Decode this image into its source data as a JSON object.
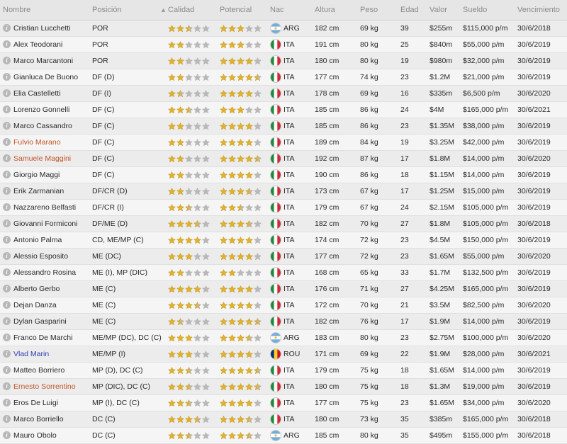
{
  "header": {
    "nombre": "Nombre",
    "posicion": "Posición",
    "calidad": "Calidad",
    "sort_arrow": "▲",
    "potencial": "Potencial",
    "nac": "Nac",
    "altura": "Altura",
    "peso": "Peso",
    "edad": "Edad",
    "valor": "Valor",
    "sueldo": "Sueldo",
    "vencimiento": "Vencimiento"
  },
  "colors": {
    "star_gold": "#e2b22a",
    "star_empty": "#b9b9b9",
    "name_orange": "#c0562a",
    "name_blue": "#2d3db0"
  },
  "players": [
    {
      "name": "Cristian Lucchetti",
      "name_color": "normal",
      "position": "POR",
      "quality": 2.5,
      "potential": 3.0,
      "nationality": "ARG",
      "height": "182 cm",
      "weight": "69 kg",
      "age": "39",
      "value": "$255m",
      "salary": "$115,000 p/m",
      "expiry": "30/6/2018"
    },
    {
      "name": "Alex Teodorani",
      "name_color": "normal",
      "position": "POR",
      "quality": 2.0,
      "potential": 3.0,
      "nationality": "ITA",
      "height": "191 cm",
      "weight": "80 kg",
      "age": "25",
      "value": "$840m",
      "salary": "$55,000 p/m",
      "expiry": "30/6/2019"
    },
    {
      "name": "Marco Marcantoni",
      "name_color": "normal",
      "position": "POR",
      "quality": 2.0,
      "potential": 4.0,
      "nationality": "ITA",
      "height": "180 cm",
      "weight": "80 kg",
      "age": "19",
      "value": "$980m",
      "salary": "$32,000 p/m",
      "expiry": "30/6/2019"
    },
    {
      "name": "Gianluca De Buono",
      "name_color": "normal",
      "position": "DF (D)",
      "quality": 2.0,
      "potential": 4.5,
      "nationality": "ITA",
      "height": "177 cm",
      "weight": "74 kg",
      "age": "23",
      "value": "$1.2M",
      "salary": "$21,000 p/m",
      "expiry": "30/6/2019"
    },
    {
      "name": "Elia Castelletti",
      "name_color": "normal",
      "position": "DF (I)",
      "quality": 1.5,
      "potential": 4.0,
      "nationality": "ITA",
      "height": "178 cm",
      "weight": "69 kg",
      "age": "16",
      "value": "$335m",
      "salary": "$6,500 p/m",
      "expiry": "30/6/2020"
    },
    {
      "name": "Lorenzo Gonnelli",
      "name_color": "normal",
      "position": "DF (C)",
      "quality": 2.5,
      "potential": 3.0,
      "nationality": "ITA",
      "height": "185 cm",
      "weight": "86 kg",
      "age": "24",
      "value": "$4M",
      "salary": "$165,000 p/m",
      "expiry": "30/6/2021"
    },
    {
      "name": "Marco Cassandro",
      "name_color": "normal",
      "position": "DF (C)",
      "quality": 2.0,
      "potential": 4.0,
      "nationality": "ITA",
      "height": "185 cm",
      "weight": "86 kg",
      "age": "23",
      "value": "$1.35M",
      "salary": "$38,000 p/m",
      "expiry": "30/6/2019"
    },
    {
      "name": "Fulvio Marano",
      "name_color": "orange",
      "position": "DF (C)",
      "quality": 2.0,
      "potential": 4.0,
      "nationality": "ITA",
      "height": "189 cm",
      "weight": "84 kg",
      "age": "19",
      "value": "$3.25M",
      "salary": "$42,000 p/m",
      "expiry": "30/6/2019"
    },
    {
      "name": "Samuele Maggini",
      "name_color": "orange",
      "position": "DF (C)",
      "quality": 2.0,
      "potential": 4.5,
      "nationality": "ITA",
      "height": "192 cm",
      "weight": "87 kg",
      "age": "17",
      "value": "$1.8M",
      "salary": "$14,000 p/m",
      "expiry": "30/6/2020"
    },
    {
      "name": "Giorgio Maggi",
      "name_color": "normal",
      "position": "DF (C)",
      "quality": 2.0,
      "potential": 4.0,
      "nationality": "ITA",
      "height": "190 cm",
      "weight": "86 kg",
      "age": "18",
      "value": "$1.15M",
      "salary": "$14,000 p/m",
      "expiry": "30/6/2019"
    },
    {
      "name": "Erik Zarmanian",
      "name_color": "normal",
      "position": "DF/CR (D)",
      "quality": 2.0,
      "potential": 3.5,
      "nationality": "ITA",
      "height": "173 cm",
      "weight": "67 kg",
      "age": "17",
      "value": "$1.25M",
      "salary": "$15,000 p/m",
      "expiry": "30/6/2019"
    },
    {
      "name": "Nazzareno Belfasti",
      "name_color": "normal",
      "position": "DF/CR (I)",
      "quality": 2.5,
      "potential": 2.5,
      "nationality": "ITA",
      "height": "179 cm",
      "weight": "67 kg",
      "age": "24",
      "value": "$2.15M",
      "salary": "$105,000 p/m",
      "expiry": "30/6/2019"
    },
    {
      "name": "Giovanni Formiconi",
      "name_color": "normal",
      "position": "DF/ME (D)",
      "quality": 3.5,
      "potential": 3.5,
      "nationality": "ITA",
      "height": "182 cm",
      "weight": "70 kg",
      "age": "27",
      "value": "$1.8M",
      "salary": "$105,000 p/m",
      "expiry": "30/6/2018"
    },
    {
      "name": "Antonio Palma",
      "name_color": "normal",
      "position": "CD, ME/MP (C)",
      "quality": 4.0,
      "potential": 4.0,
      "nationality": "ITA",
      "height": "174 cm",
      "weight": "72 kg",
      "age": "23",
      "value": "$4.5M",
      "salary": "$150,000 p/m",
      "expiry": "30/6/2019"
    },
    {
      "name": "Alessio Esposito",
      "name_color": "normal",
      "position": "ME (DC)",
      "quality": 3.0,
      "potential": 4.0,
      "nationality": "ITA",
      "height": "177 cm",
      "weight": "72 kg",
      "age": "23",
      "value": "$1.65M",
      "salary": "$55,000 p/m",
      "expiry": "30/6/2020"
    },
    {
      "name": "Alessandro Rosina",
      "name_color": "normal",
      "position": "ME (I), MP (DIC)",
      "quality": 2.0,
      "potential": 2.0,
      "nationality": "ITA",
      "height": "168 cm",
      "weight": "65 kg",
      "age": "33",
      "value": "$1.7M",
      "salary": "$132,500 p/m",
      "expiry": "30/6/2019"
    },
    {
      "name": "Alberto Gerbo",
      "name_color": "normal",
      "position": "ME (C)",
      "quality": 4.0,
      "potential": 4.0,
      "nationality": "ITA",
      "height": "176 cm",
      "weight": "71 kg",
      "age": "27",
      "value": "$4.25M",
      "salary": "$165,000 p/m",
      "expiry": "30/6/2019"
    },
    {
      "name": "Dejan Danza",
      "name_color": "normal",
      "position": "ME (C)",
      "quality": 3.5,
      "potential": 4.0,
      "nationality": "ITA",
      "height": "172 cm",
      "weight": "70 kg",
      "age": "21",
      "value": "$3.5M",
      "salary": "$82,500 p/m",
      "expiry": "30/6/2020"
    },
    {
      "name": "Dylan Gasparini",
      "name_color": "normal",
      "position": "ME (C)",
      "quality": 1.5,
      "potential": 4.5,
      "nationality": "ITA",
      "height": "182 cm",
      "weight": "76 kg",
      "age": "17",
      "value": "$1.9M",
      "salary": "$14,000 p/m",
      "expiry": "30/6/2019"
    },
    {
      "name": "Franco De Marchi",
      "name_color": "normal",
      "position": "ME/MP (DC), DC (C)",
      "quality": 3.0,
      "potential": 3.5,
      "nationality": "ARG",
      "height": "183 cm",
      "weight": "80 kg",
      "age": "23",
      "value": "$2.75M",
      "salary": "$100,000 p/m",
      "expiry": "30/6/2020"
    },
    {
      "name": "Vlad Marin",
      "name_color": "blue",
      "position": "ME/MP (I)",
      "quality": 3.0,
      "potential": 4.0,
      "nationality": "ROU",
      "height": "171 cm",
      "weight": "69 kg",
      "age": "22",
      "value": "$1.9M",
      "salary": "$28,000 p/m",
      "expiry": "30/6/2021"
    },
    {
      "name": "Matteo Borriero",
      "name_color": "normal",
      "position": "MP (D), DC (C)",
      "quality": 2.5,
      "potential": 4.5,
      "nationality": "ITA",
      "height": "179 cm",
      "weight": "75 kg",
      "age": "18",
      "value": "$1.65M",
      "salary": "$14,000 p/m",
      "expiry": "30/6/2019"
    },
    {
      "name": "Ernesto Sorrentino",
      "name_color": "orange",
      "position": "MP (DIC), DC (C)",
      "quality": 2.5,
      "potential": 4.5,
      "nationality": "ITA",
      "height": "180 cm",
      "weight": "75 kg",
      "age": "18",
      "value": "$1.3M",
      "salary": "$19,000 p/m",
      "expiry": "30/6/2019"
    },
    {
      "name": "Eros De Luigi",
      "name_color": "normal",
      "position": "MP (I), DC (C)",
      "quality": 2.5,
      "potential": 4.0,
      "nationality": "ITA",
      "height": "177 cm",
      "weight": "75 kg",
      "age": "23",
      "value": "$1.65M",
      "salary": "$34,000 p/m",
      "expiry": "30/6/2020"
    },
    {
      "name": "Marco Borriello",
      "name_color": "normal",
      "position": "DC (C)",
      "quality": 3.5,
      "potential": 3.5,
      "nationality": "ITA",
      "height": "180 cm",
      "weight": "73 kg",
      "age": "35",
      "value": "$385m",
      "salary": "$165,000 p/m",
      "expiry": "30/6/2018"
    },
    {
      "name": "Mauro Obolo",
      "name_color": "normal",
      "position": "DC (C)",
      "quality": 2.5,
      "potential": 3.5,
      "nationality": "ARG",
      "height": "185 cm",
      "weight": "80 kg",
      "age": "35",
      "value": "$495m",
      "salary": "$155,000 p/m",
      "expiry": "30/6/2018"
    }
  ]
}
